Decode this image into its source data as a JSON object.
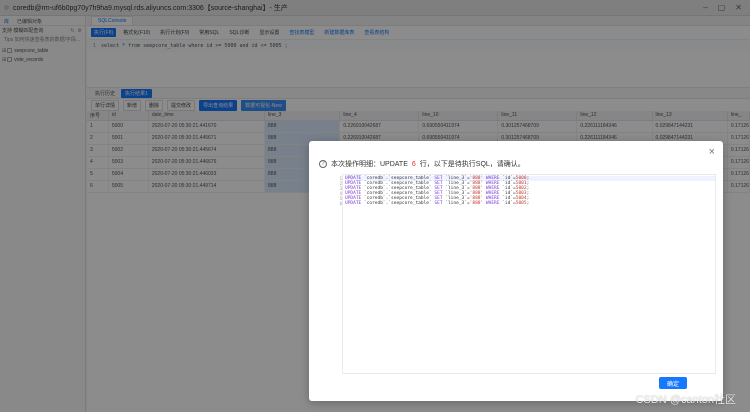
{
  "window": {
    "title": "coredb@rm-uf6b0pg70y7h9ha9.mysql.rds.aliyuncs.com:3306【source-shanghai】- 生产"
  },
  "sidebar": {
    "tabs": [
      "库",
      "已编辑对象"
    ],
    "tools_row": "支持  模糊匹配查询",
    "search_placeholder": "Tips 如何快速查看表的数据/字段...",
    "tables": [
      {
        "label": "seepcore_table"
      },
      {
        "label": "vote_records"
      }
    ]
  },
  "editor": {
    "tab": "SQLConsole",
    "toolbar": {
      "run": "执行(F8)",
      "format": "格式化(F10)",
      "plan": "执行计划(F9)",
      "common_sql": "常用SQL",
      "sql_diag": "SQL诊断",
      "settings": "显示设置",
      "links": [
        "查找表模型",
        "新建数据库表",
        "查看表结构"
      ]
    },
    "sql": "select * from seepcore_table where id >= 5000 and id <= 5005 ;"
  },
  "results": {
    "tabs": [
      "执行历史",
      "执行结果1"
    ],
    "toolbar": {
      "history": "单行详情",
      "add": "新增",
      "delete": "删除",
      "submit": "提交修改",
      "export": "导出查询结果",
      "more": "数据可视化-New"
    },
    "columns": [
      "序号",
      "id",
      "date_time",
      "line_3",
      "line_4",
      "line_10",
      "line_11",
      "line_12",
      "line_13",
      "line_"
    ],
    "rows": [
      [
        "1",
        "5000",
        "2020-07-20 05:30:21.441670",
        "888",
        "0.226910042687",
        "0.690550411974",
        "0.301257468709",
        "0.226111184346",
        "0.029847144231",
        "0.17126"
      ],
      [
        "2",
        "5001",
        "2020-07-20 05:30:21.445671",
        "888",
        "0.226910042687",
        "0.690550411974",
        "0.301257468709",
        "0.226111184346",
        "0.029847144231",
        "0.17126"
      ],
      [
        "3",
        "5002",
        "2020-07-20 05:30:21.445674",
        "888",
        "0.226910042687",
        "0.690550411974",
        "0.301257468709",
        "0.226111184346",
        "0.029847144231",
        "0.17126"
      ],
      [
        "4",
        "5003",
        "2020-07-20 05:30:21.446676",
        "888",
        "0.226910042687",
        "0.690550411974",
        "0.301257468709",
        "0.226111184346",
        "0.029847144231",
        "0.17126"
      ],
      [
        "5",
        "5004",
        "2020-07-20 05:30:21.446033",
        "888",
        "0.226910042687",
        "0.690550411974",
        "0.301257468709",
        "0.226111184346",
        "0.029847144231",
        "0.17126"
      ],
      [
        "6",
        "5005",
        "2020-07-20 05:30:21.449714",
        "888",
        "0.226910042687",
        "0.690550411974",
        "0.301257468709",
        "0.226111184346",
        "0.029847144231",
        "0.17126"
      ]
    ]
  },
  "modal": {
    "title_prefix": "本次操作明细：UPDATE",
    "count": "6",
    "title_suffix": "行，以下是待执行SQL，请确认。",
    "close": "×",
    "sql_lines": [
      {
        "pre": "UPDATE ",
        "tbl": "`coredb`.`seepcore_table`",
        "mid": " SET ",
        "col": "`line_3`",
        "eq": "=",
        "v": "'888'",
        "where": " WHERE ",
        "idc": "`id`",
        "eq2": "=",
        "id": "5000",
        "end": ";"
      },
      {
        "pre": "UPDATE ",
        "tbl": "`coredb`.`seepcore_table`",
        "mid": " SET ",
        "col": "`line_3`",
        "eq": "=",
        "v": "'888'",
        "where": " WHERE ",
        "idc": "`id`",
        "eq2": "=",
        "id": "5001",
        "end": ";"
      },
      {
        "pre": "UPDATE ",
        "tbl": "`coredb`.`seepcore_table`",
        "mid": " SET ",
        "col": "`line_3`",
        "eq": "=",
        "v": "'888'",
        "where": " WHERE ",
        "idc": "`id`",
        "eq2": "=",
        "id": "5002",
        "end": ";"
      },
      {
        "pre": "UPDATE ",
        "tbl": "`coredb`.`seepcore_table`",
        "mid": " SET ",
        "col": "`line_3`",
        "eq": "=",
        "v": "'888'",
        "where": " WHERE ",
        "idc": "`id`",
        "eq2": "=",
        "id": "5003",
        "end": ";"
      },
      {
        "pre": "UPDATE ",
        "tbl": "`coredb`.`seepcore_table`",
        "mid": " SET ",
        "col": "`line_3`",
        "eq": "=",
        "v": "'888'",
        "where": " WHERE ",
        "idc": "`id`",
        "eq2": "=",
        "id": "5004",
        "end": ";"
      },
      {
        "pre": "UPDATE ",
        "tbl": "`coredb`.`seepcore_table`",
        "mid": " SET ",
        "col": "`line_3`",
        "eq": "=",
        "v": "'888'",
        "where": " WHERE ",
        "idc": "`id`",
        "eq2": "=",
        "id": "5005",
        "end": ";"
      }
    ],
    "confirm": "确定",
    "watermark": "CSDN @canton社区"
  },
  "colors": {
    "accent": "#1677ff",
    "count": "#f5222d",
    "keyword": "#7a3fd6",
    "string": "#c0392b"
  }
}
